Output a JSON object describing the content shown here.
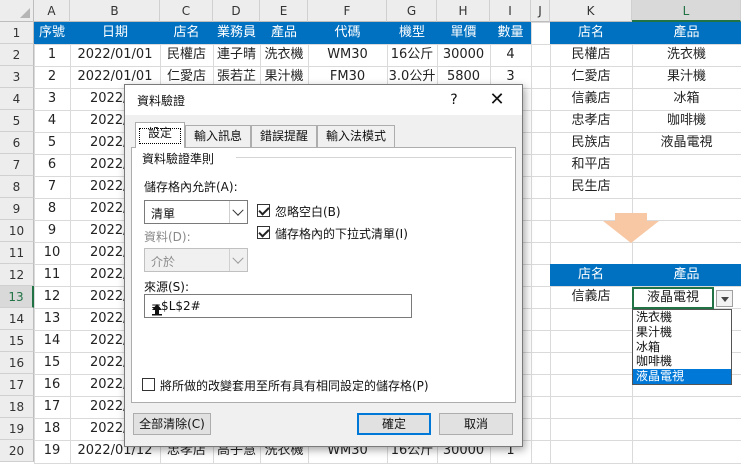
{
  "columns": [
    "A",
    "B",
    "C",
    "D",
    "E",
    "F",
    "G",
    "H",
    "I",
    "J",
    "K",
    "L"
  ],
  "rows": [
    "1",
    "2",
    "3",
    "4",
    "5",
    "6",
    "7",
    "8",
    "9",
    "10",
    "11",
    "12",
    "13",
    "14",
    "15",
    "16",
    "17",
    "18",
    "19",
    "20"
  ],
  "table_headers": [
    "序號",
    "日期",
    "店名",
    "業務員",
    "產品",
    "代碼",
    "機型",
    "單價",
    "數量"
  ],
  "table_rows": [
    [
      "1",
      "2022/01/01",
      "民權店",
      "連子晴",
      "洗衣機",
      "WM30",
      "16公斤",
      "30000",
      "4"
    ],
    [
      "2",
      "2022/01/01",
      "仁愛店",
      "張若芷",
      "果汁機",
      "FM30",
      "3.0公升",
      "5800",
      "3"
    ],
    [
      "3",
      "2022/0"
    ],
    [
      "4",
      "2022/0"
    ],
    [
      "5",
      "2022/0"
    ],
    [
      "6",
      "2022/0"
    ],
    [
      "7",
      "2022/0"
    ],
    [
      "8",
      "2022/0"
    ],
    [
      "9",
      "2022/0"
    ],
    [
      "10",
      "2022/0"
    ],
    [
      "11",
      "2022/0"
    ],
    [
      "12",
      "2022/0"
    ],
    [
      "13",
      "2022/0"
    ],
    [
      "14",
      "2022/0"
    ],
    [
      "15",
      "2022/0"
    ],
    [
      "16",
      "2022/0"
    ],
    [
      "17",
      "2022/0"
    ],
    [
      "18",
      "2022/0"
    ],
    [
      "19",
      "2022/01/12",
      "忠孝店",
      "高子慧",
      "洗衣機",
      "WM30",
      "16公斤",
      "30000",
      "1"
    ]
  ],
  "lookup": {
    "header_store": "店名",
    "header_product": "產品",
    "stores": [
      "民權店",
      "仁愛店",
      "信義店",
      "忠孝店",
      "民族店",
      "和平店",
      "民生店"
    ],
    "products": [
      "洗衣機",
      "果汁機",
      "冰箱",
      "咖啡機",
      "液晶電視"
    ]
  },
  "form": {
    "header_store": "店名",
    "header_product": "產品",
    "store_value": "信義店",
    "product_value": "液晶電視",
    "dropdown_options": [
      "洗衣機",
      "果汁機",
      "冰箱",
      "咖啡機",
      "液晶電視"
    ],
    "dropdown_selected": "液晶電視"
  },
  "dialog": {
    "title": "資料驗證",
    "help": "?",
    "close": "✕",
    "tabs": [
      "設定",
      "輸入訊息",
      "錯誤提醒",
      "輸入法模式"
    ],
    "active_tab": "設定",
    "group_label": "資料驗證準則",
    "allow_label": "儲存格內允許(A):",
    "allow_value": "清單",
    "ignore_blank": "忽略空白(B)",
    "in_cell_dropdown": "儲存格內的下拉式清單(I)",
    "data_label": "資料(D):",
    "data_value": "介於",
    "source_label": "來源(S):",
    "source_value": "=$L$2#",
    "apply_all": "將所做的改變套用至所有具有相同設定的儲存格(P)",
    "clear_all": "全部清除(C)",
    "ok": "確定",
    "cancel": "取消"
  },
  "colors": {
    "header_fill": "#0070c0",
    "arrow": "#f8c8a4",
    "selection": "#217346",
    "highlight": "#0078d7"
  }
}
